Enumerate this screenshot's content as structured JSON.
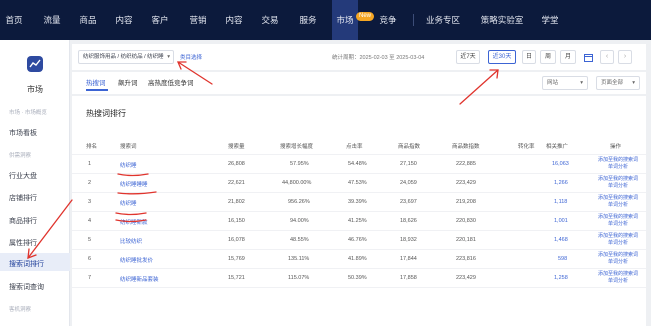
{
  "topnav": {
    "items": [
      "首页",
      "流量",
      "商品",
      "内容",
      "客户",
      "营销",
      "内容",
      "交易",
      "服务",
      "市场",
      "竞争",
      "业务专区",
      "策略实验室",
      "学堂"
    ],
    "new_badge": "New"
  },
  "sidebar": {
    "title": "市场",
    "group1": "市场 · 市场概览",
    "dashboard": "市场看板",
    "group2": "供需洞察",
    "industry": "行业大盘",
    "shop_rank": "店铺排行",
    "product_rank": "商品排行",
    "attr_rank": "属性排行",
    "search_rank": "搜索词排行",
    "search_query": "搜索词查询",
    "group3": "客机洞察"
  },
  "toolbar": {
    "crumb": "纺织服饰用品 / 纺织纺品 / 纺织睡",
    "crumb_link": "类目选择",
    "period": "统计周期：2025-02-03 至 2025-03-04",
    "btn_7": "近7天",
    "btn_30": "近30天",
    "btn_day": "日",
    "btn_week": "周",
    "btn_month": "月",
    "prev": "‹",
    "next": "›"
  },
  "tabs": {
    "hot": "热搜词",
    "rising": "飙升词",
    "gap": "高热度低竞争词",
    "select1": "网站",
    "select2": "页面全部"
  },
  "table": {
    "title": "热搜词排行",
    "headers": [
      "排名",
      "搜索词",
      "搜索量",
      "搜索增长幅度",
      "点击率",
      "商品指数",
      "商品数指数",
      "转化率",
      "相关推广",
      "操作"
    ],
    "rows": [
      {
        "rank": "1",
        "kw": "纺织睡",
        "v1": "26,808",
        "v2": "57.95%",
        "v3": "54.48%",
        "v4": "27,150",
        "v5": "222,885",
        "v6": "16,063"
      },
      {
        "rank": "2",
        "kw": "纺织睡睡睡",
        "v1": "22,621",
        "v2": "44,800.00%",
        "v3": "47.53%",
        "v4": "24,059",
        "v5": "223,429",
        "v6": "1,266"
      },
      {
        "rank": "3",
        "kw": "纺织睡",
        "v1": "21,802",
        "v2": "956.26%",
        "v3": "39.39%",
        "v4": "23,697",
        "v5": "219,208",
        "v6": "1,118"
      },
      {
        "rank": "4",
        "kw": "纺织睡新款",
        "v1": "16,150",
        "v2": "94.00%",
        "v3": "41.25%",
        "v4": "18,626",
        "v5": "220,830",
        "v6": "1,001"
      },
      {
        "rank": "5",
        "kw": "比较纺织",
        "v1": "16,078",
        "v2": "48.55%",
        "v3": "46.76%",
        "v4": "18,932",
        "v5": "220,181",
        "v6": "1,468"
      },
      {
        "rank": "6",
        "kw": "纺织睡批发价",
        "v1": "15,769",
        "v2": "135.11%",
        "v3": "41.89%",
        "v4": "17,844",
        "v5": "223,816",
        "v6": "598"
      },
      {
        "rank": "7",
        "kw": "纺织睡新品套装",
        "v1": "15,721",
        "v2": "115.07%",
        "v3": "50.39%",
        "v4": "17,858",
        "v5": "223,429",
        "v6": "1,258"
      }
    ],
    "op1": "添加至我的搜索词",
    "op2": "单词分析"
  }
}
